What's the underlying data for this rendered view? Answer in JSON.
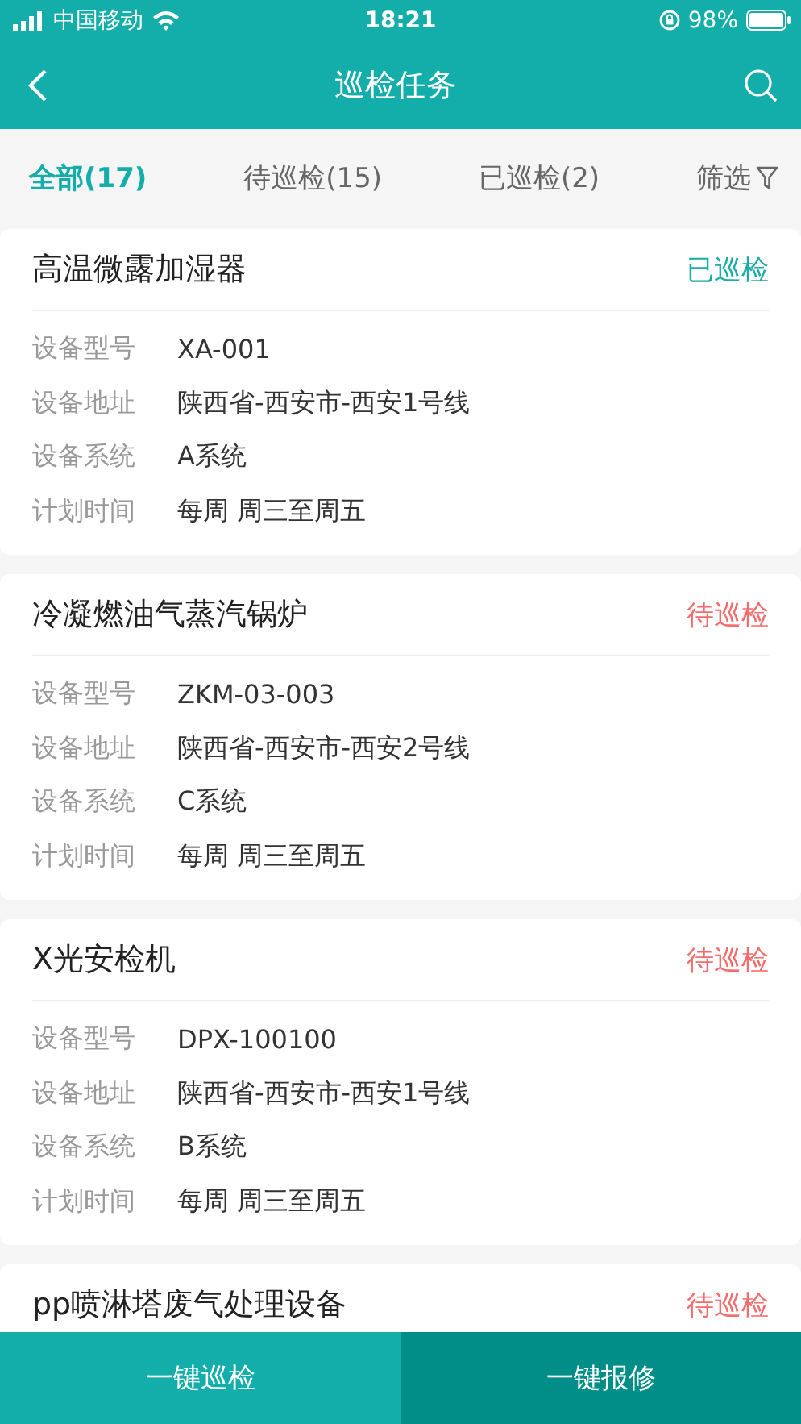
{
  "status_bar": {
    "carrier": "中国移动",
    "time": "18:21",
    "battery": "98%"
  },
  "nav": {
    "title": "巡检任务"
  },
  "tabs": [
    {
      "label": "全部(17)",
      "selected": true
    },
    {
      "label": "待巡检(15)",
      "selected": false
    },
    {
      "label": "已巡检(2)",
      "selected": false
    }
  ],
  "filter": {
    "label": "筛选"
  },
  "tasks": [
    {
      "name": "高温微露加湿器",
      "status": {
        "kind": "done",
        "label": "已巡检"
      },
      "fields": [
        {
          "label": "设备型号",
          "value": "XA-001"
        },
        {
          "label": "设备地址",
          "value": "陕西省-西安市-西安1号线"
        },
        {
          "label": "设备系统",
          "value": "A系统"
        },
        {
          "label": "计划时间",
          "value": "每周 周三至周五"
        }
      ]
    },
    {
      "name": "冷凝燃油气蒸汽锅炉",
      "status": {
        "kind": "pending",
        "label": "待巡检"
      },
      "fields": [
        {
          "label": "设备型号",
          "value": "ZKM-03-003"
        },
        {
          "label": "设备地址",
          "value": "陕西省-西安市-西安2号线"
        },
        {
          "label": "设备系统",
          "value": "C系统"
        },
        {
          "label": "计划时间",
          "value": "每周 周三至周五"
        }
      ]
    },
    {
      "name": "X光安检机",
      "status": {
        "kind": "pending",
        "label": "待巡检"
      },
      "fields": [
        {
          "label": "设备型号",
          "value": "DPX-100100"
        },
        {
          "label": "设备地址",
          "value": "陕西省-西安市-西安1号线"
        },
        {
          "label": "设备系统",
          "value": "B系统"
        },
        {
          "label": "计划时间",
          "value": "每周 周三至周五"
        }
      ]
    },
    {
      "name": "pp喷淋塔废气处理设备",
      "status": {
        "kind": "pending",
        "label": "待巡检"
      }
    }
  ],
  "actions": [
    {
      "label": "一键巡检",
      "kind": "primary"
    },
    {
      "label": "一键报修",
      "kind": "secondary"
    }
  ]
}
